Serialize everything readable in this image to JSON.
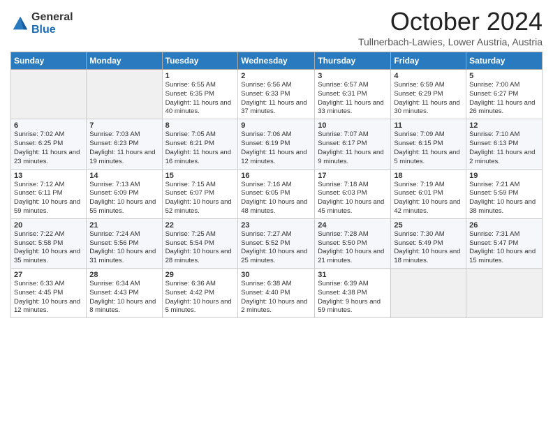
{
  "logo": {
    "general": "General",
    "blue": "Blue"
  },
  "title": "October 2024",
  "subtitle": "Tullnerbach-Lawies, Lower Austria, Austria",
  "days_of_week": [
    "Sunday",
    "Monday",
    "Tuesday",
    "Wednesday",
    "Thursday",
    "Friday",
    "Saturday"
  ],
  "weeks": [
    [
      {
        "day": "",
        "sunrise": "",
        "sunset": "",
        "daylight": ""
      },
      {
        "day": "",
        "sunrise": "",
        "sunset": "",
        "daylight": ""
      },
      {
        "day": "1",
        "sunrise": "Sunrise: 6:55 AM",
        "sunset": "Sunset: 6:35 PM",
        "daylight": "Daylight: 11 hours and 40 minutes."
      },
      {
        "day": "2",
        "sunrise": "Sunrise: 6:56 AM",
        "sunset": "Sunset: 6:33 PM",
        "daylight": "Daylight: 11 hours and 37 minutes."
      },
      {
        "day": "3",
        "sunrise": "Sunrise: 6:57 AM",
        "sunset": "Sunset: 6:31 PM",
        "daylight": "Daylight: 11 hours and 33 minutes."
      },
      {
        "day": "4",
        "sunrise": "Sunrise: 6:59 AM",
        "sunset": "Sunset: 6:29 PM",
        "daylight": "Daylight: 11 hours and 30 minutes."
      },
      {
        "day": "5",
        "sunrise": "Sunrise: 7:00 AM",
        "sunset": "Sunset: 6:27 PM",
        "daylight": "Daylight: 11 hours and 26 minutes."
      }
    ],
    [
      {
        "day": "6",
        "sunrise": "Sunrise: 7:02 AM",
        "sunset": "Sunset: 6:25 PM",
        "daylight": "Daylight: 11 hours and 23 minutes."
      },
      {
        "day": "7",
        "sunrise": "Sunrise: 7:03 AM",
        "sunset": "Sunset: 6:23 PM",
        "daylight": "Daylight: 11 hours and 19 minutes."
      },
      {
        "day": "8",
        "sunrise": "Sunrise: 7:05 AM",
        "sunset": "Sunset: 6:21 PM",
        "daylight": "Daylight: 11 hours and 16 minutes."
      },
      {
        "day": "9",
        "sunrise": "Sunrise: 7:06 AM",
        "sunset": "Sunset: 6:19 PM",
        "daylight": "Daylight: 11 hours and 12 minutes."
      },
      {
        "day": "10",
        "sunrise": "Sunrise: 7:07 AM",
        "sunset": "Sunset: 6:17 PM",
        "daylight": "Daylight: 11 hours and 9 minutes."
      },
      {
        "day": "11",
        "sunrise": "Sunrise: 7:09 AM",
        "sunset": "Sunset: 6:15 PM",
        "daylight": "Daylight: 11 hours and 5 minutes."
      },
      {
        "day": "12",
        "sunrise": "Sunrise: 7:10 AM",
        "sunset": "Sunset: 6:13 PM",
        "daylight": "Daylight: 11 hours and 2 minutes."
      }
    ],
    [
      {
        "day": "13",
        "sunrise": "Sunrise: 7:12 AM",
        "sunset": "Sunset: 6:11 PM",
        "daylight": "Daylight: 10 hours and 59 minutes."
      },
      {
        "day": "14",
        "sunrise": "Sunrise: 7:13 AM",
        "sunset": "Sunset: 6:09 PM",
        "daylight": "Daylight: 10 hours and 55 minutes."
      },
      {
        "day": "15",
        "sunrise": "Sunrise: 7:15 AM",
        "sunset": "Sunset: 6:07 PM",
        "daylight": "Daylight: 10 hours and 52 minutes."
      },
      {
        "day": "16",
        "sunrise": "Sunrise: 7:16 AM",
        "sunset": "Sunset: 6:05 PM",
        "daylight": "Daylight: 10 hours and 48 minutes."
      },
      {
        "day": "17",
        "sunrise": "Sunrise: 7:18 AM",
        "sunset": "Sunset: 6:03 PM",
        "daylight": "Daylight: 10 hours and 45 minutes."
      },
      {
        "day": "18",
        "sunrise": "Sunrise: 7:19 AM",
        "sunset": "Sunset: 6:01 PM",
        "daylight": "Daylight: 10 hours and 42 minutes."
      },
      {
        "day": "19",
        "sunrise": "Sunrise: 7:21 AM",
        "sunset": "Sunset: 5:59 PM",
        "daylight": "Daylight: 10 hours and 38 minutes."
      }
    ],
    [
      {
        "day": "20",
        "sunrise": "Sunrise: 7:22 AM",
        "sunset": "Sunset: 5:58 PM",
        "daylight": "Daylight: 10 hours and 35 minutes."
      },
      {
        "day": "21",
        "sunrise": "Sunrise: 7:24 AM",
        "sunset": "Sunset: 5:56 PM",
        "daylight": "Daylight: 10 hours and 31 minutes."
      },
      {
        "day": "22",
        "sunrise": "Sunrise: 7:25 AM",
        "sunset": "Sunset: 5:54 PM",
        "daylight": "Daylight: 10 hours and 28 minutes."
      },
      {
        "day": "23",
        "sunrise": "Sunrise: 7:27 AM",
        "sunset": "Sunset: 5:52 PM",
        "daylight": "Daylight: 10 hours and 25 minutes."
      },
      {
        "day": "24",
        "sunrise": "Sunrise: 7:28 AM",
        "sunset": "Sunset: 5:50 PM",
        "daylight": "Daylight: 10 hours and 21 minutes."
      },
      {
        "day": "25",
        "sunrise": "Sunrise: 7:30 AM",
        "sunset": "Sunset: 5:49 PM",
        "daylight": "Daylight: 10 hours and 18 minutes."
      },
      {
        "day": "26",
        "sunrise": "Sunrise: 7:31 AM",
        "sunset": "Sunset: 5:47 PM",
        "daylight": "Daylight: 10 hours and 15 minutes."
      }
    ],
    [
      {
        "day": "27",
        "sunrise": "Sunrise: 6:33 AM",
        "sunset": "Sunset: 4:45 PM",
        "daylight": "Daylight: 10 hours and 12 minutes."
      },
      {
        "day": "28",
        "sunrise": "Sunrise: 6:34 AM",
        "sunset": "Sunset: 4:43 PM",
        "daylight": "Daylight: 10 hours and 8 minutes."
      },
      {
        "day": "29",
        "sunrise": "Sunrise: 6:36 AM",
        "sunset": "Sunset: 4:42 PM",
        "daylight": "Daylight: 10 hours and 5 minutes."
      },
      {
        "day": "30",
        "sunrise": "Sunrise: 6:38 AM",
        "sunset": "Sunset: 4:40 PM",
        "daylight": "Daylight: 10 hours and 2 minutes."
      },
      {
        "day": "31",
        "sunrise": "Sunrise: 6:39 AM",
        "sunset": "Sunset: 4:38 PM",
        "daylight": "Daylight: 9 hours and 59 minutes."
      },
      {
        "day": "",
        "sunrise": "",
        "sunset": "",
        "daylight": ""
      },
      {
        "day": "",
        "sunrise": "",
        "sunset": "",
        "daylight": ""
      }
    ]
  ]
}
